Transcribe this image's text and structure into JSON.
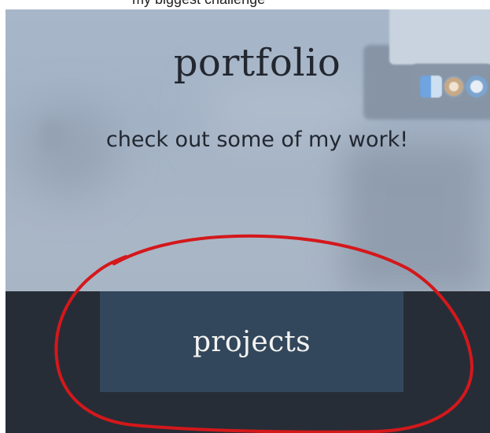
{
  "cropped_top_text": "my biggest challenge",
  "hero": {
    "title": "portfolio",
    "subtitle": "check out some of my work!"
  },
  "cta": {
    "label": "projects"
  },
  "colors": {
    "hero_bg": "#a7b7c9",
    "text_dark": "#222730",
    "footer_bg": "#272d36",
    "button_bg": "#33475c",
    "button_text": "#f4f4f2",
    "annotation_red": "#d4181b"
  },
  "icons": [
    "finder-icon",
    "photos-icon",
    "safari-icon"
  ]
}
